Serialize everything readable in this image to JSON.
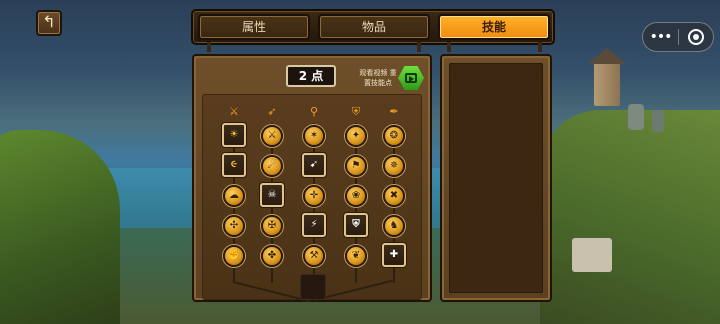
{
  "back_icon": "return-arrow-icon",
  "capsule": {
    "more_icon": "more-dots-icon",
    "close_icon": "target-circle-icon",
    "more_text": "•••"
  },
  "tabs": [
    {
      "label": "属性",
      "active": false
    },
    {
      "label": "物品",
      "active": false
    },
    {
      "label": "技能",
      "active": true
    }
  ],
  "skills_panel": {
    "points": "2 点",
    "reset_label": "观看视频 重置技能点",
    "video_icon": "video-play-icon",
    "categories": [
      "sword-icon",
      "crossbow-icon",
      "staff-icon",
      "shield-icon",
      "quill-icon"
    ],
    "grid": [
      [
        "☀",
        "⚔",
        "✶",
        "✦",
        "❂"
      ],
      [
        "૯",
        "☄",
        "➹",
        "⚑",
        "✵"
      ],
      [
        "☁",
        "☠",
        "✛",
        "❀",
        "✖"
      ],
      [
        "✣",
        "✠",
        "⚡",
        "⛨",
        "♞"
      ],
      [
        "✊",
        "✤",
        "⚒",
        "❦",
        "✚"
      ]
    ]
  },
  "colors": {
    "active_tab": "#f5961a",
    "panel": "#5c4020",
    "video_button": "#3cbd22"
  }
}
